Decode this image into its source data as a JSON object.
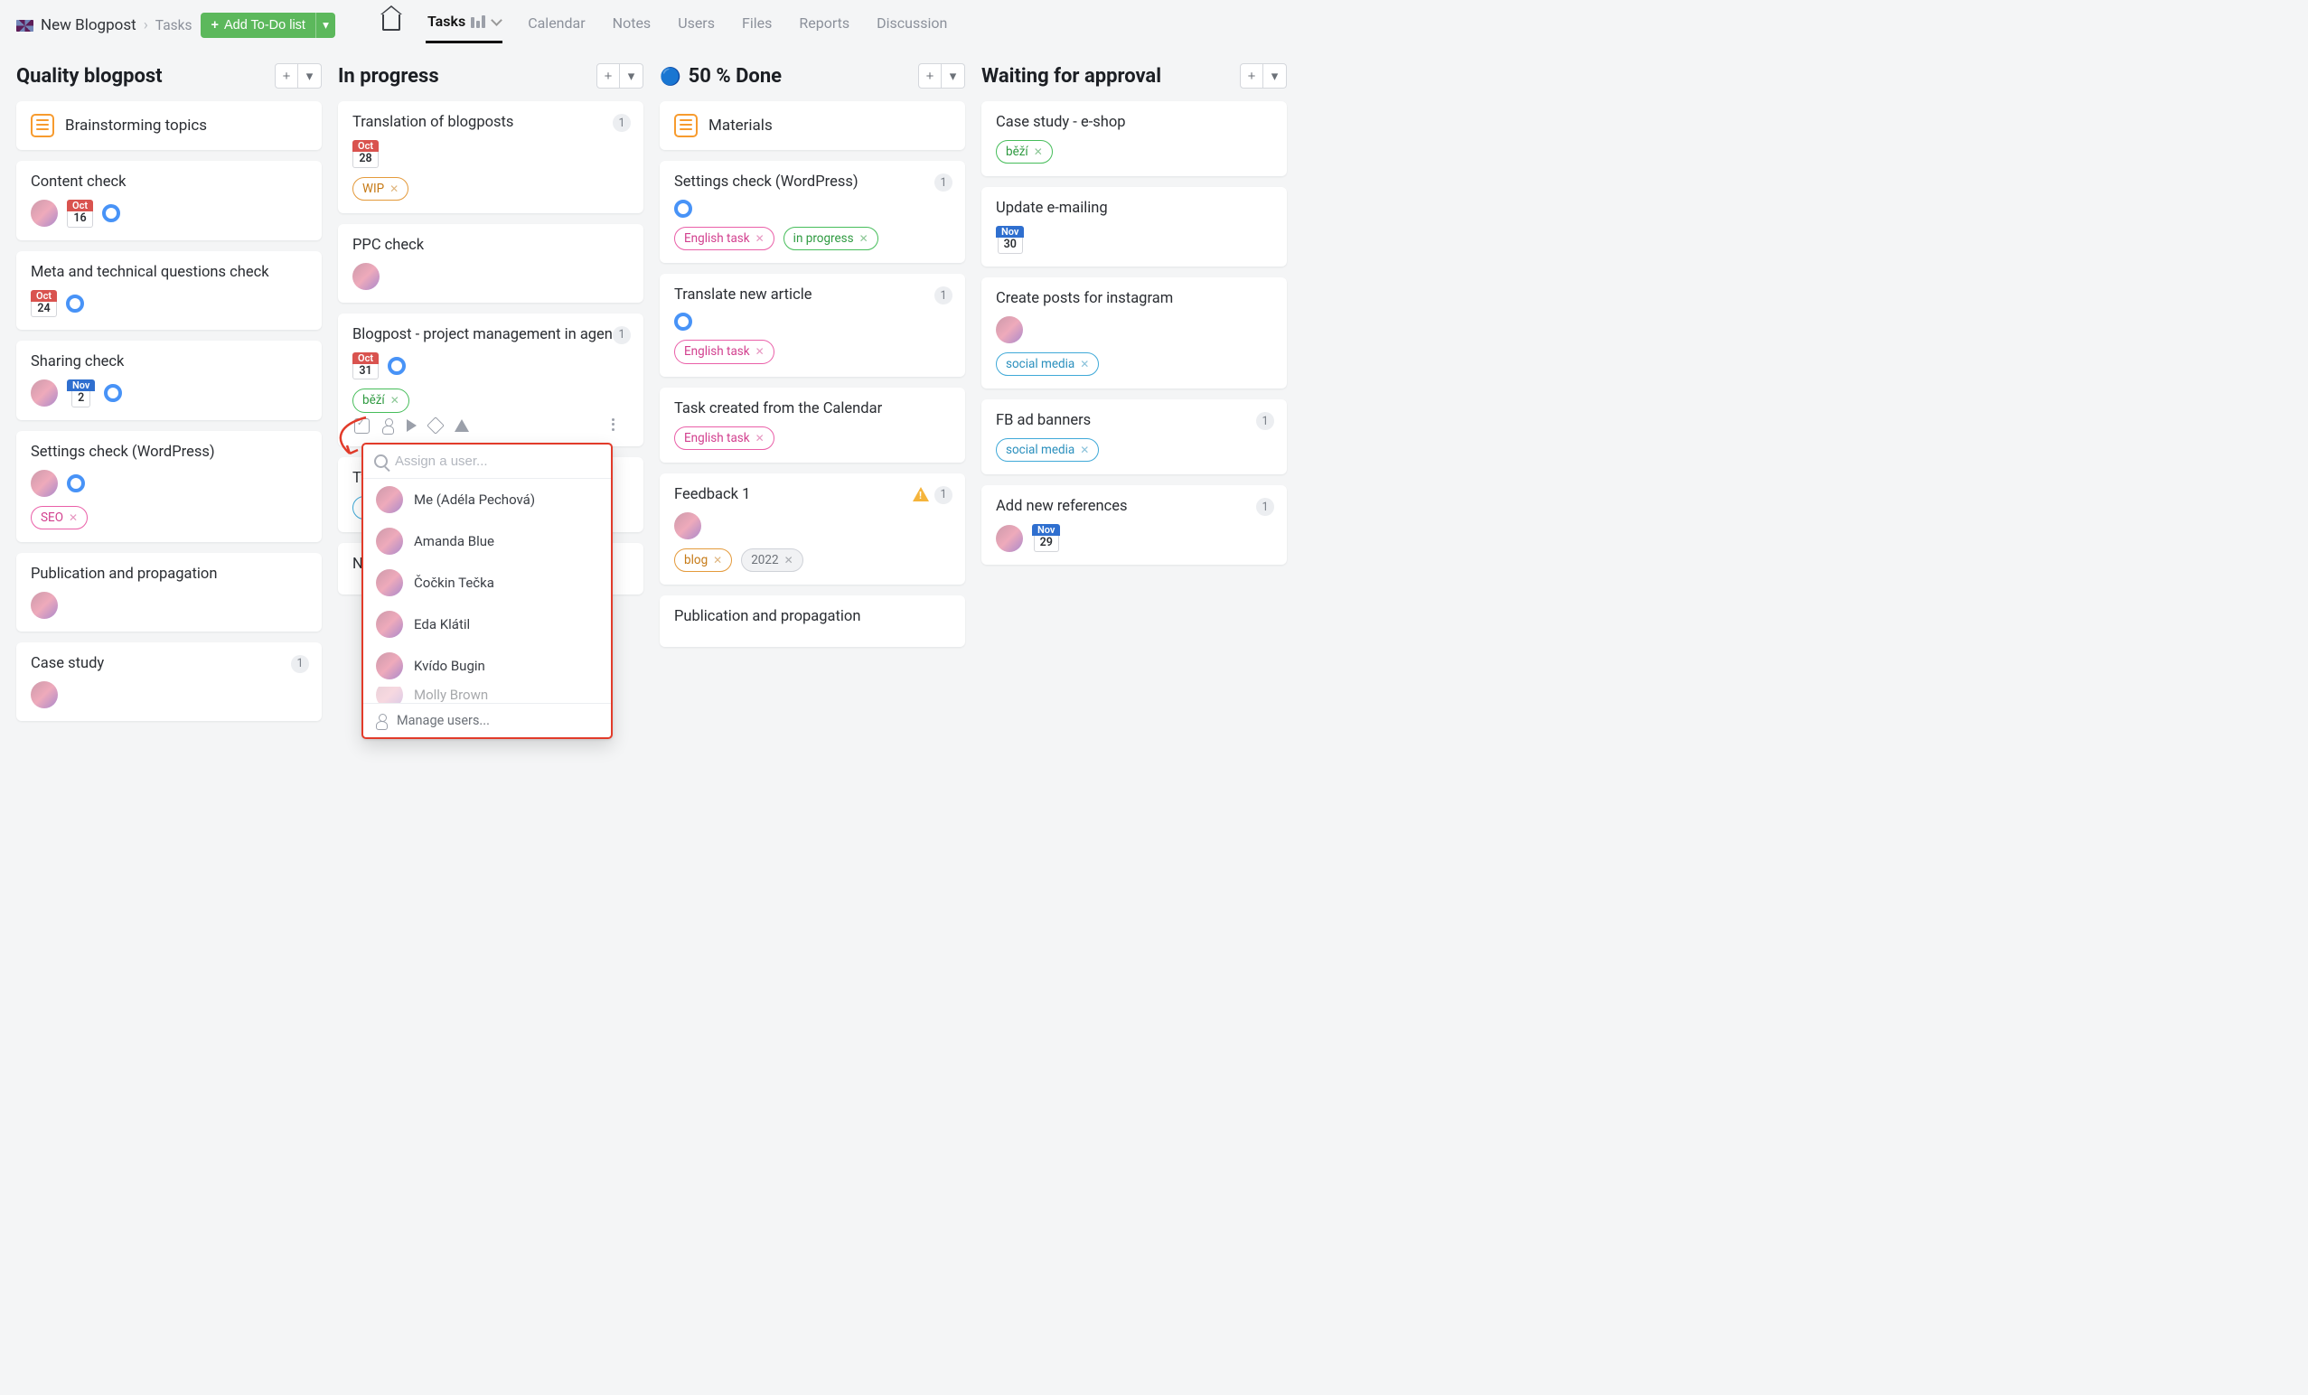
{
  "breadcrumb": {
    "project": "New Blogpost",
    "section": "Tasks"
  },
  "addList": {
    "label": "Add To-Do list"
  },
  "nav": [
    "Tasks",
    "Calendar",
    "Notes",
    "Users",
    "Files",
    "Reports",
    "Discussion"
  ],
  "columns": [
    {
      "title": "Quality blogpost",
      "cards": [
        {
          "type": "header",
          "title": "Brainstorming topics"
        },
        {
          "title": "Content check",
          "avatar": true,
          "date": {
            "m": "Oct",
            "d": "16"
          },
          "ring": true
        },
        {
          "title": "Meta and technical questions check",
          "date": {
            "m": "Oct",
            "d": "24"
          },
          "ring": true
        },
        {
          "title": "Sharing check",
          "avatar": true,
          "date": {
            "m": "Nov",
            "d": "2"
          },
          "ring": true
        },
        {
          "title": "Settings check (WordPress)",
          "avatar": true,
          "ring": true,
          "tags": [
            {
              "text": "SEO",
              "color": "pink"
            }
          ]
        },
        {
          "title": "Publication and propagation",
          "avatar": true
        },
        {
          "title": "Case study",
          "avatar": true,
          "count": "1"
        }
      ]
    },
    {
      "title": "In progress",
      "cards": [
        {
          "title": "Translation of blogposts",
          "count": "1",
          "date": {
            "m": "Oct",
            "d": "28"
          },
          "tags": [
            {
              "text": "WIP",
              "color": "orange"
            }
          ]
        },
        {
          "title": "PPC check",
          "avatar": true
        },
        {
          "title": "Blogpost - project management in agency",
          "count": "1",
          "date": {
            "m": "Oct",
            "d": "31"
          },
          "ring": true,
          "tags": [
            {
              "text": "běží",
              "color": "green"
            }
          ],
          "actions": true
        },
        {
          "title": "Tw",
          "tagsPartial": true
        },
        {
          "title": "Ne"
        }
      ]
    },
    {
      "title": "50 % Done",
      "emoji": "🔵",
      "cards": [
        {
          "type": "header",
          "title": "Materials"
        },
        {
          "title": "Settings check (WordPress)",
          "count": "1",
          "ring": true,
          "tags": [
            {
              "text": "English task",
              "color": "pink"
            },
            {
              "text": "in progress",
              "color": "green"
            }
          ]
        },
        {
          "title": "Translate new article",
          "count": "1",
          "ring": true,
          "tags": [
            {
              "text": "English task",
              "color": "pink"
            }
          ]
        },
        {
          "title": "Task created from the Calendar",
          "tags": [
            {
              "text": "English task",
              "color": "pink"
            }
          ]
        },
        {
          "title": "Feedback 1",
          "count": "1",
          "warn": true,
          "avatar": true,
          "tags": [
            {
              "text": "blog",
              "color": "orange"
            },
            {
              "text": "2022",
              "color": "gray"
            }
          ]
        },
        {
          "title": "Publication and propagation"
        }
      ]
    },
    {
      "title": "Waiting for approval",
      "cards": [
        {
          "title": "Case study - e-shop",
          "tags": [
            {
              "text": "běží",
              "color": "green"
            }
          ]
        },
        {
          "title": "Update e-mailing",
          "date": {
            "m": "Nov",
            "d": "30"
          }
        },
        {
          "title": "Create posts for instagram",
          "avatar": true,
          "tags": [
            {
              "text": "social media",
              "color": "cyan"
            }
          ]
        },
        {
          "title": "FB ad banners",
          "count": "1",
          "tags": [
            {
              "text": "social media",
              "color": "cyan"
            }
          ]
        },
        {
          "title": "Add new references",
          "count": "1",
          "avatar": true,
          "date": {
            "m": "Nov",
            "d": "29"
          }
        }
      ]
    }
  ],
  "assignPopup": {
    "placeholder": "Assign a user...",
    "users": [
      "Me (Adéla Pechová)",
      "Amanda Blue",
      "Čočkin Tečka",
      "Eda Klátil",
      "Kvído Bugin",
      "Molly Brown"
    ],
    "manage": "Manage users..."
  }
}
